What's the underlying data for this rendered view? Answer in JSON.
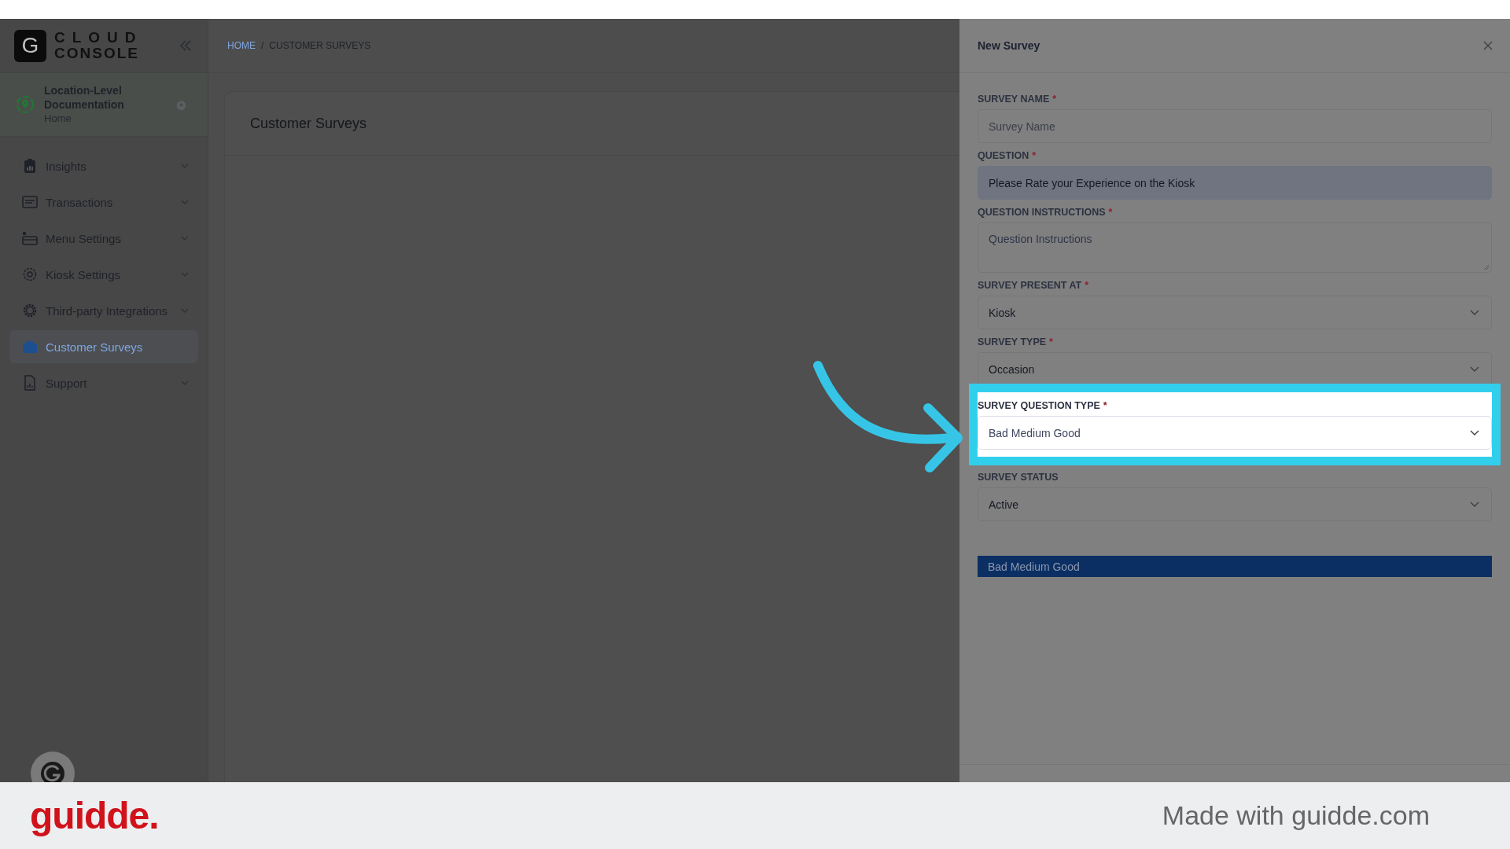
{
  "logo": {
    "mark": "G",
    "line1": "CLOUD",
    "line2": "CONSOLE"
  },
  "location": {
    "name": "Location-Level Documentation",
    "sub": "Home"
  },
  "sidebar": {
    "items": [
      {
        "label": "Insights",
        "expandable": true,
        "selected": false
      },
      {
        "label": "Transactions",
        "expandable": true,
        "selected": false
      },
      {
        "label": "Menu Settings",
        "expandable": true,
        "selected": false
      },
      {
        "label": "Kiosk Settings",
        "expandable": true,
        "selected": false
      },
      {
        "label": "Third-party Integrations",
        "expandable": true,
        "selected": false
      },
      {
        "label": "Customer Surveys",
        "expandable": false,
        "selected": true
      },
      {
        "label": "Support",
        "expandable": true,
        "selected": false
      }
    ]
  },
  "breadcrumb": {
    "separator": "/",
    "items": [
      {
        "label": "HOME",
        "kind": "link"
      },
      {
        "label": "CUSTOMER SURVEYS",
        "kind": "current"
      }
    ]
  },
  "page_title": "Customer Surveys",
  "drawer": {
    "title": "New Survey",
    "required_mark": "*",
    "fields": [
      {
        "label": "SURVEY NAME",
        "required": true,
        "kind": "input",
        "placeholder": "Survey Name",
        "autofilled": false,
        "highlighted": false
      },
      {
        "label": "QUESTION",
        "required": true,
        "kind": "input",
        "value": "Please Rate your Experience on the Kiosk",
        "autofilled": true,
        "highlighted": false
      },
      {
        "label": "QUESTION INSTRUCTIONS",
        "required": true,
        "kind": "textarea",
        "placeholder": "Question Instructions",
        "autofilled": false,
        "highlighted": false
      },
      {
        "label": "SURVEY PRESENT AT",
        "required": true,
        "kind": "select",
        "value": "Kiosk",
        "autofilled": false,
        "highlighted": false
      },
      {
        "label": "SURVEY TYPE",
        "required": true,
        "kind": "select",
        "value": "Occasion",
        "autofilled": false,
        "highlighted": false
      },
      {
        "label": "SURVEY QUESTION TYPE",
        "required": true,
        "kind": "select",
        "value": "Bad Medium Good",
        "autofilled": false,
        "highlighted": true
      },
      {
        "label": "SURVEY STATUS",
        "required": false,
        "kind": "select",
        "value": "Active",
        "autofilled": false,
        "highlighted": false
      }
    ],
    "dropdown_options": [
      {
        "label": "Bad Medium Good",
        "selected": true
      }
    ]
  },
  "footer": {
    "brand": "guidde.",
    "made_with": "Made with guidde.com"
  }
}
